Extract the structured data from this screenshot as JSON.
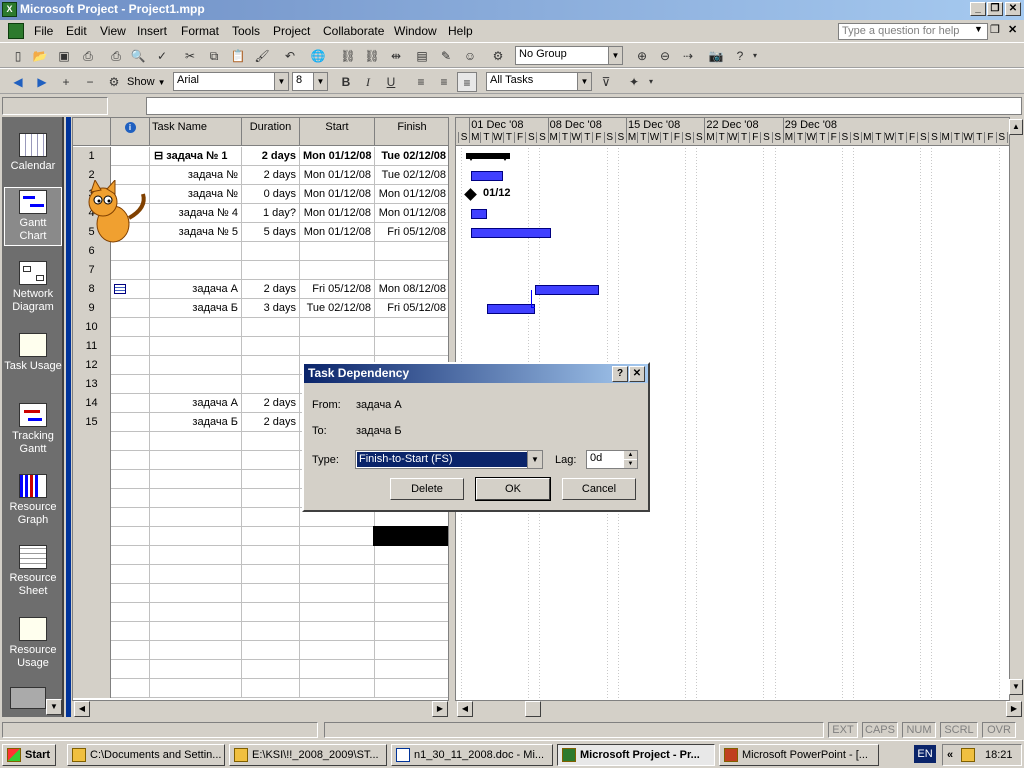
{
  "window": {
    "title": "Microsoft Project - Project1.mpp",
    "app_icon": "X"
  },
  "menu": [
    "File",
    "Edit",
    "View",
    "Insert",
    "Format",
    "Tools",
    "Project",
    "Collaborate",
    "Window",
    "Help"
  ],
  "help_placeholder": "Type a question for help",
  "toolbar": {
    "group_value": "No Group",
    "show_label": "Show",
    "font_value": "Arial",
    "size_value": "8",
    "filter_value": "All Tasks"
  },
  "views": [
    {
      "label": "Calendar",
      "icon": "calendar-icon"
    },
    {
      "label": "Gantt Chart",
      "icon": "gantt-chart-icon"
    },
    {
      "label": "Network Diagram",
      "icon": "network-diagram-icon"
    },
    {
      "label": "Task Usage",
      "icon": "task-usage-icon"
    },
    {
      "label": "Tracking Gantt",
      "icon": "tracking-gantt-icon"
    },
    {
      "label": "Resource Graph",
      "icon": "resource-graph-icon"
    },
    {
      "label": "Resource Sheet",
      "icon": "resource-sheet-icon"
    },
    {
      "label": "Resource Usage",
      "icon": "resource-usage-icon"
    }
  ],
  "table": {
    "headers": [
      "Task Name",
      "Duration",
      "Start",
      "Finish"
    ],
    "rows": [
      {
        "n": "1",
        "name": "задача № 1",
        "dur": "2 days",
        "start": "Mon 01/12/08",
        "finish": "Tue 02/12/08",
        "summary": true
      },
      {
        "n": "2",
        "name": "задача №",
        "dur": "2 days",
        "start": "Mon 01/12/08",
        "finish": "Tue 02/12/08"
      },
      {
        "n": "3",
        "name": "задача №",
        "dur": "0 days",
        "start": "Mon 01/12/08",
        "finish": "Mon 01/12/08"
      },
      {
        "n": "4",
        "name": "задача № 4",
        "dur": "1 day?",
        "start": "Mon 01/12/08",
        "finish": "Mon 01/12/08"
      },
      {
        "n": "5",
        "name": "задача № 5",
        "dur": "5 days",
        "start": "Mon 01/12/08",
        "finish": "Fri 05/12/08"
      },
      {
        "n": "6",
        "name": "",
        "dur": "",
        "start": "",
        "finish": ""
      },
      {
        "n": "7",
        "name": "",
        "dur": "",
        "start": "",
        "finish": ""
      },
      {
        "n": "8",
        "name": "задача А",
        "dur": "2 days",
        "start": "Fri 05/12/08",
        "finish": "Mon 08/12/08"
      },
      {
        "n": "9",
        "name": "задача Б",
        "dur": "3 days",
        "start": "Tue 02/12/08",
        "finish": "Fri 05/12/08"
      },
      {
        "n": "10",
        "name": "",
        "dur": "",
        "start": "",
        "finish": ""
      },
      {
        "n": "11",
        "name": "",
        "dur": "",
        "start": "",
        "finish": ""
      },
      {
        "n": "12",
        "name": "",
        "dur": "",
        "start": "",
        "finish": ""
      },
      {
        "n": "13",
        "name": "",
        "dur": "",
        "start": "",
        "finish": ""
      },
      {
        "n": "14",
        "name": "задача А",
        "dur": "2 days",
        "start": "",
        "finish": ""
      },
      {
        "n": "15",
        "name": "задача Б",
        "dur": "2 days",
        "start": "",
        "finish": ""
      }
    ]
  },
  "gantt": {
    "weeks": [
      "01 Dec '08",
      "08 Dec '08",
      "15 Dec '08",
      "22 Dec '08",
      "29 Dec '08"
    ],
    "days": [
      "S",
      "M",
      "T",
      "W",
      "T",
      "F",
      "S"
    ],
    "milestone_label": "01/12"
  },
  "dialog": {
    "title": "Task Dependency",
    "from_label": "From:",
    "from_value": "задача А",
    "to_label": "To:",
    "to_value": "задача Б",
    "type_label": "Type:",
    "type_value": "Finish-to-Start (FS)",
    "lag_label": "Lag:",
    "lag_value": "0d",
    "delete": "Delete",
    "ok": "OK",
    "cancel": "Cancel"
  },
  "status": [
    "EXT",
    "CAPS",
    "NUM",
    "SCRL",
    "OVR"
  ],
  "taskbar": {
    "start": "Start",
    "tasks": [
      "C:\\Documents and Settin...",
      "E:\\KSI\\!!_2008_2009\\ST...",
      "n1_30_11_2008.doc - Mi...",
      "Microsoft Project - Pr...",
      "Microsoft PowerPoint - [..."
    ],
    "lang": "EN",
    "clock": "18:21"
  }
}
